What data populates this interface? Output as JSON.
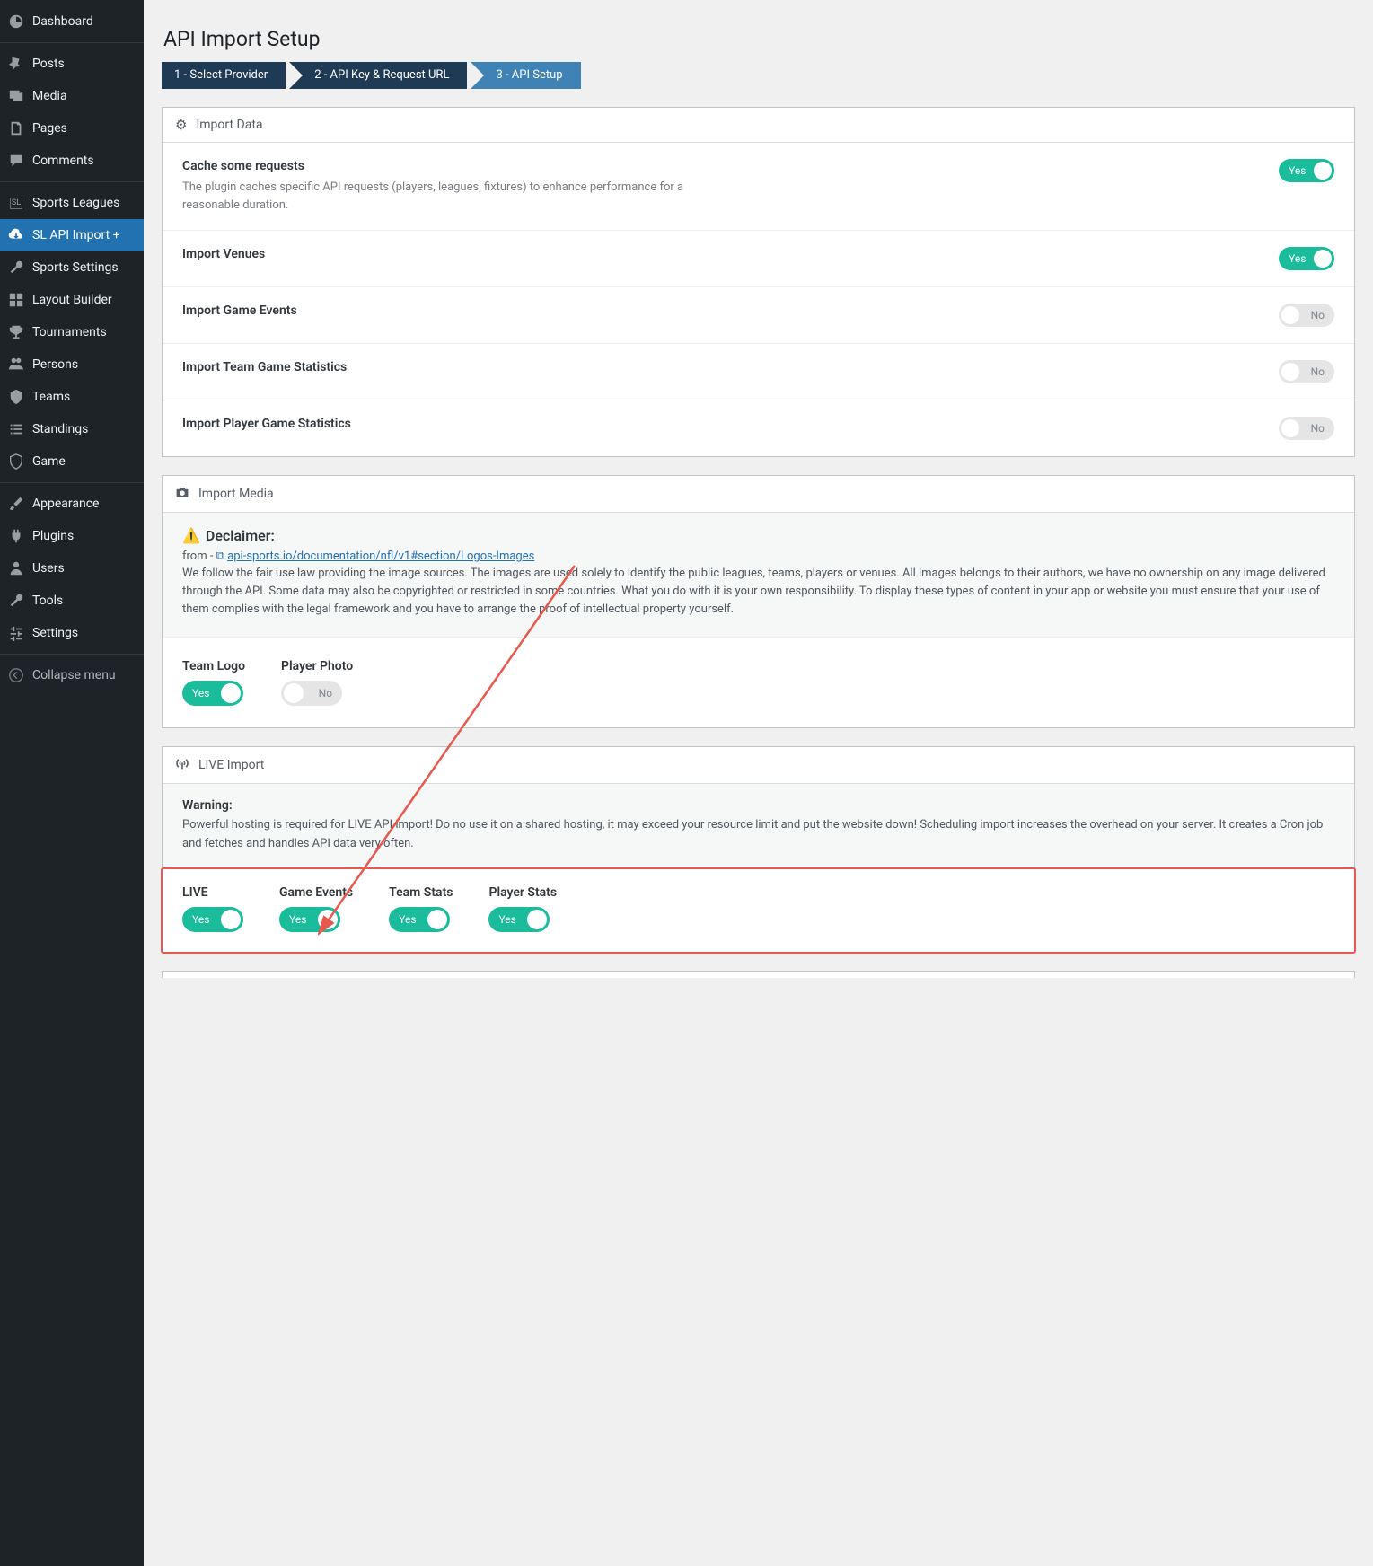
{
  "sidebar": {
    "items": [
      {
        "label": "Dashboard"
      },
      {
        "label": "Posts"
      },
      {
        "label": "Media"
      },
      {
        "label": "Pages"
      },
      {
        "label": "Comments"
      },
      {
        "label": "Sports Leagues"
      },
      {
        "label": "SL API Import +"
      },
      {
        "label": "Sports Settings"
      },
      {
        "label": "Layout Builder"
      },
      {
        "label": "Tournaments"
      },
      {
        "label": "Persons"
      },
      {
        "label": "Teams"
      },
      {
        "label": "Standings"
      },
      {
        "label": "Game"
      },
      {
        "label": "Appearance"
      },
      {
        "label": "Plugins"
      },
      {
        "label": "Users"
      },
      {
        "label": "Tools"
      },
      {
        "label": "Settings"
      },
      {
        "label": "Collapse menu"
      }
    ]
  },
  "page": {
    "title": "API Import Setup"
  },
  "steps": [
    {
      "label": "1 - Select Provider"
    },
    {
      "label": "2 - API Key & Request URL"
    },
    {
      "label": "3 - API Setup"
    }
  ],
  "import_data": {
    "header": "Import Data",
    "cache": {
      "title": "Cache some requests",
      "desc": "The plugin caches specific API requests (players, leagues, fixtures) to enhance performance for a reasonable duration.",
      "value": "Yes"
    },
    "venues": {
      "title": "Import Venues",
      "value": "Yes"
    },
    "events": {
      "title": "Import Game Events",
      "value": "No"
    },
    "team_stats": {
      "title": "Import Team Game Statistics",
      "value": "No"
    },
    "player_stats": {
      "title": "Import Player Game Statistics",
      "value": "No"
    }
  },
  "import_media": {
    "header": "Import Media",
    "disclaimer_title": "Declaimer:",
    "from_label": "from - ",
    "link": "api-sports.io/documentation/nfl/v1#section/Logos-Images",
    "text": "We follow the fair use law providing the image sources. The images are used solely to identify the public leagues, teams, players or venues. All images belongs to their authors, we have no ownership on any image delivered through the API. Some data may also be copyrighted or restricted in some countries. What you do with it is your own responsibility. To display these types of content in your app or website you must ensure that your use of them complies with the legal framework and you have to arrange the proof of intellectual property yourself.",
    "team_logo": {
      "label": "Team Logo",
      "value": "Yes"
    },
    "player_photo": {
      "label": "Player Photo",
      "value": "No"
    }
  },
  "live_import": {
    "header": "LIVE Import",
    "warning_title": "Warning:",
    "warning_text": "Powerful hosting is required for LIVE API import! Do no use it on a shared hosting, it may exceed your resource limit and put the website down! Scheduling import increases the overhead on your server. It creates a Cron job and fetches and handles API data very often.",
    "live": {
      "label": "LIVE",
      "value": "Yes"
    },
    "game_events": {
      "label": "Game Events",
      "value": "Yes"
    },
    "team_stats": {
      "label": "Team Stats",
      "value": "Yes"
    },
    "player_stats": {
      "label": "Player Stats",
      "value": "Yes"
    }
  }
}
